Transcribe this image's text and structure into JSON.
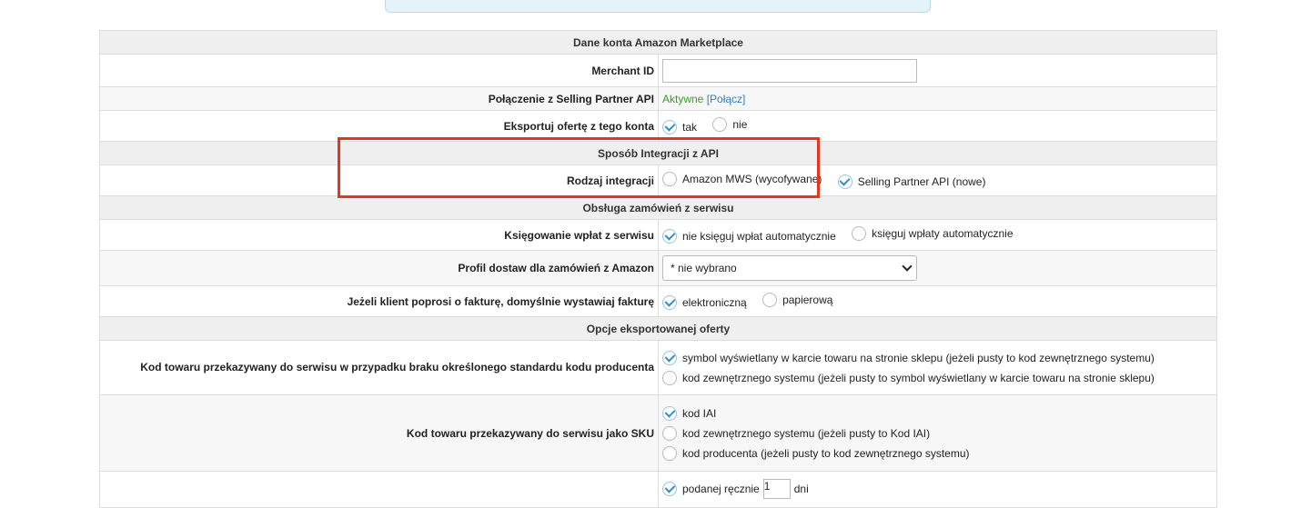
{
  "section_account": "Dane konta Amazon Marketplace",
  "merchant": {
    "label": "Merchant ID",
    "value": ""
  },
  "spapi": {
    "label": "Połączenie z Selling Partner API",
    "status": "Aktywne",
    "link": "[Połącz]"
  },
  "export_offer": {
    "label": "Eksportuj ofertę z tego konta",
    "options": [
      "tak",
      "nie"
    ],
    "selected": 0
  },
  "section_integration": "Sposób Integracji z API",
  "integration_type": {
    "label": "Rodzaj integracji",
    "options": [
      "Amazon MWS (wycofywane)",
      "Selling Partner API (nowe)"
    ],
    "selected": 1
  },
  "section_orders": "Obsługa zamówień z serwisu",
  "payments": {
    "label": "Księgowanie wpłat z serwisu",
    "options": [
      "nie księguj wpłat automatycznie",
      "księguj wpłaty automatycznie"
    ],
    "selected": 0
  },
  "delivery_profile": {
    "label": "Profil dostaw dla zamówień z Amazon",
    "value": "* nie wybrano"
  },
  "invoice": {
    "label": "Jeżeli klient poprosi o fakturę, domyślnie wystawiaj fakturę",
    "options": [
      "elektroniczną",
      "papierową"
    ],
    "selected": 0
  },
  "section_offer": "Opcje eksportowanej oferty",
  "product_code": {
    "label": "Kod towaru przekazywany do serwisu w przypadku braku określonego standardu kodu producenta",
    "options": [
      "symbol wyświetlany w karcie towaru na stronie sklepu (jeżeli pusty to kod zewnętrznego systemu)",
      "kod zewnętrznego systemu (jeżeli pusty to symbol wyświetlany w karcie towaru na stronie sklepu)"
    ],
    "selected": 0
  },
  "sku": {
    "label": "Kod towaru przekazywany do serwisu jako SKU",
    "options": [
      "kod IAI",
      "kod zewnętrznego systemu (jeżeli pusty to Kod IAI)",
      "kod producenta (jeżeli pusty to kod zewnętrznego systemu)"
    ],
    "selected": 0
  },
  "partial_row": {
    "option": "podanej ręcznie",
    "days_value": "1",
    "days_unit": "dni"
  }
}
